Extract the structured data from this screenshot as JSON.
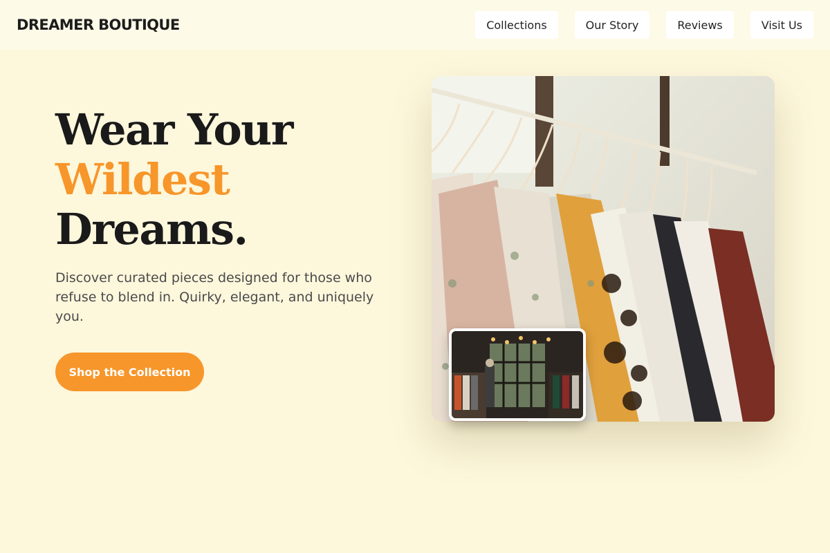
{
  "header": {
    "brand": "DREAMER BOUTIQUE",
    "nav": [
      {
        "label": "Collections"
      },
      {
        "label": "Our Story"
      },
      {
        "label": "Reviews"
      },
      {
        "label": "Visit Us"
      }
    ]
  },
  "hero": {
    "headline_line1": "Wear Your",
    "headline_accent": "Wildest",
    "headline_line3": "Dreams.",
    "subcopy": "Discover curated pieces designed for those who refuse to blend in. Quirky, elegant, and uniquely you.",
    "cta_label": "Shop the Collection"
  },
  "colors": {
    "background": "#fdf7dc",
    "accent": "#f7962a",
    "text": "#1a1a1a"
  }
}
